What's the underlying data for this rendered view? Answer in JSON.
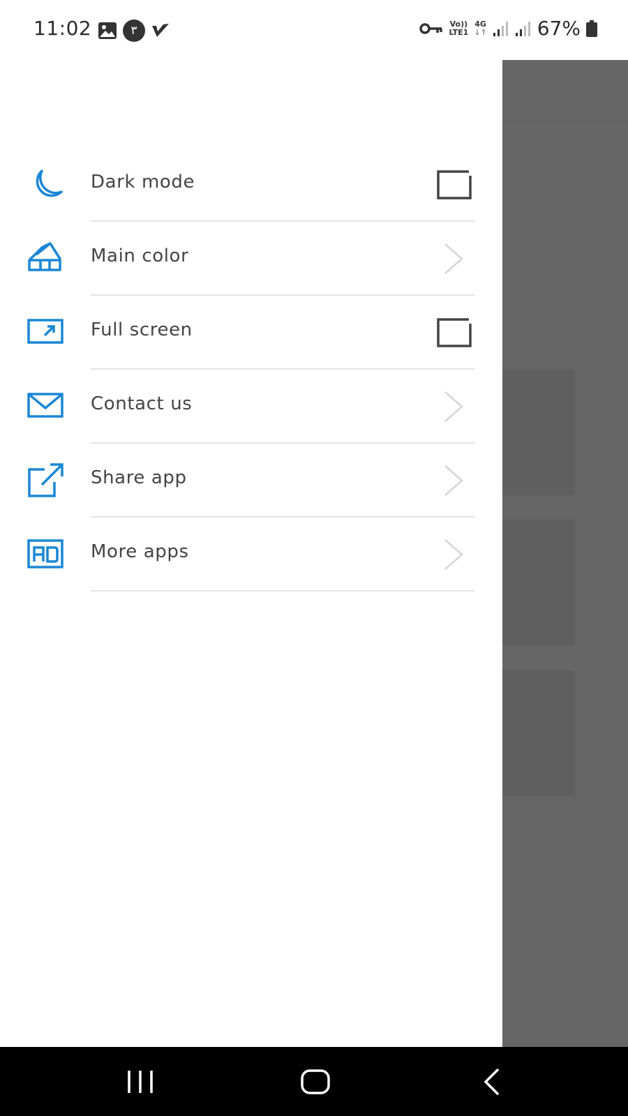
{
  "status_bar": {
    "time": "11:02",
    "notification_badge": "٣",
    "lte_top": "Vo))",
    "lte_bottom": "LTE1",
    "network": "4G",
    "battery": "67%"
  },
  "drawer": {
    "items": [
      {
        "label": "Dark mode",
        "icon": "moon-icon",
        "trailing": "checkbox",
        "checked": false
      },
      {
        "label": "Main color",
        "icon": "palette-icon",
        "trailing": "chevron"
      },
      {
        "label": "Full screen",
        "icon": "fullscreen-icon",
        "trailing": "checkbox",
        "checked": false
      },
      {
        "label": "Contact us",
        "icon": "mail-icon",
        "trailing": "chevron"
      },
      {
        "label": "Share app",
        "icon": "share-icon",
        "trailing": "chevron"
      },
      {
        "label": "More apps",
        "icon": "ad-icon",
        "trailing": "chevron"
      }
    ]
  },
  "colors": {
    "accent": "#1a86d6",
    "scrim": "#666666",
    "text": "#444444",
    "divider": "#e4e4e4"
  }
}
